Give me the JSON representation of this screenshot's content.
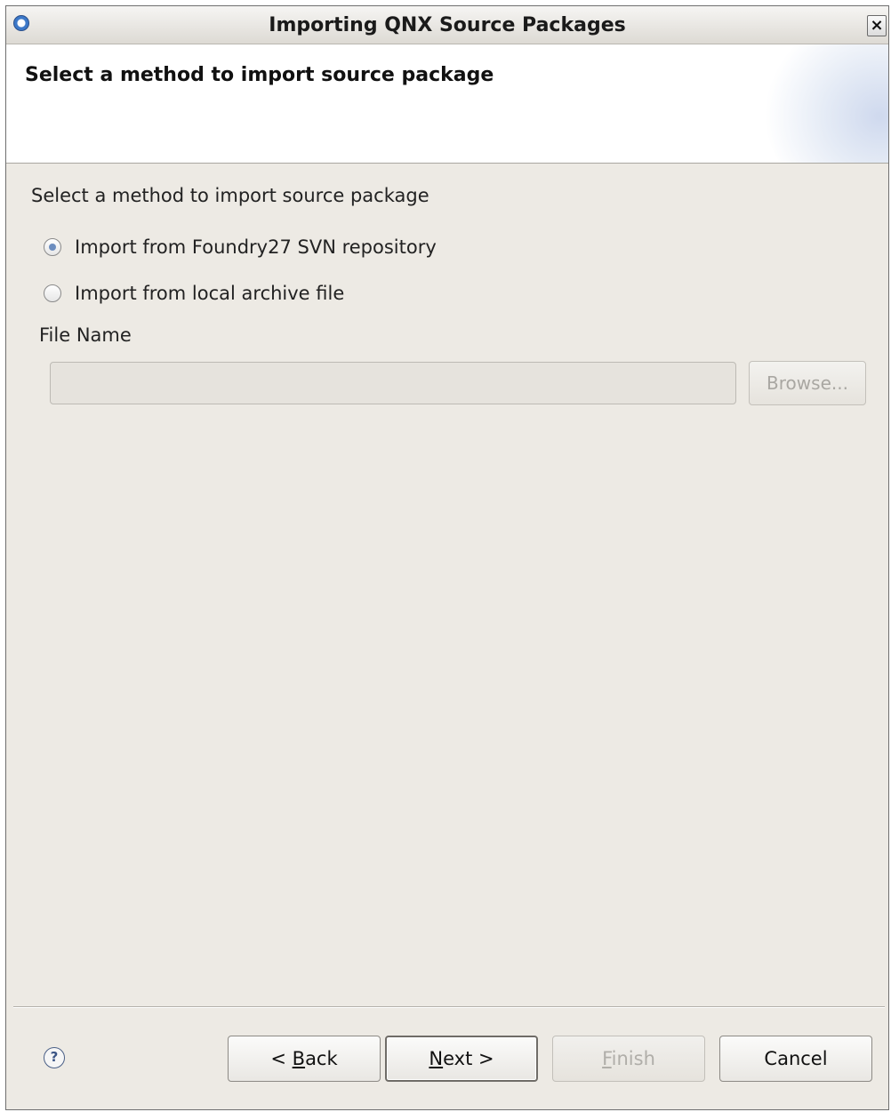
{
  "window": {
    "title": "Importing QNX Source Packages",
    "close_glyph": "×"
  },
  "banner": {
    "title": "Select a method to import source package"
  },
  "content": {
    "description": "Select a method to import source package",
    "options": [
      {
        "label": "Import from Foundry27 SVN repository",
        "selected": true
      },
      {
        "label": "Import from local archive file",
        "selected": false
      }
    ],
    "file_name_label": "File Name",
    "file_name_value": "",
    "browse_label": "Browse..."
  },
  "footer": {
    "help_glyph": "?",
    "buttons": {
      "back": {
        "pre": "< ",
        "mnemonic": "B",
        "post": "ack",
        "enabled": true
      },
      "next": {
        "pre": "",
        "mnemonic": "N",
        "post": "ext >",
        "enabled": true,
        "default": true
      },
      "finish": {
        "pre": "",
        "mnemonic": "F",
        "post": "inish",
        "enabled": false
      },
      "cancel": {
        "label": "Cancel",
        "enabled": true
      }
    }
  },
  "colors": {
    "dialog_background": "#edeae4",
    "banner_background": "#ffffff",
    "radio_dot": "#6c8dbf",
    "disabled_text": "#b0aea9"
  },
  "icons": {
    "app": "eclipse-app-icon",
    "close": "close-icon",
    "help": "help-icon"
  }
}
